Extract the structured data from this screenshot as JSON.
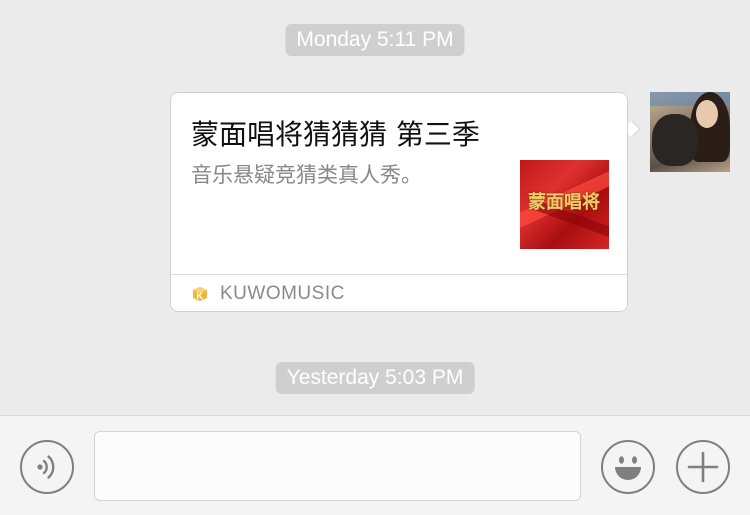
{
  "timestamps": {
    "first": "Monday 5:11 PM",
    "second": "Yesterday 5:03 PM"
  },
  "card": {
    "title": "蒙面唱将猜猜猜 第三季",
    "description": "音乐悬疑竞猜类真人秀。",
    "thumbnail_text": "蒙面唱将",
    "source": "KUWOMUSIC"
  },
  "icons": {
    "voice": "voice-icon",
    "emoji": "smiley-icon",
    "plus": "plus-icon",
    "source": "kuwo-logo-icon"
  }
}
